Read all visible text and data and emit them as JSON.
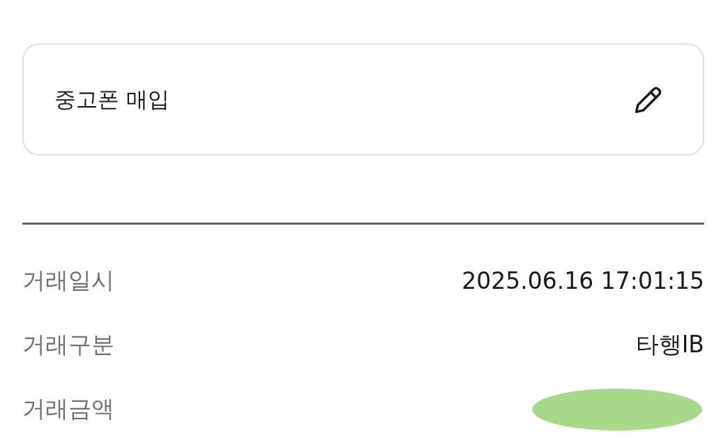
{
  "title_card": {
    "text": "중고폰 매입"
  },
  "details": [
    {
      "label": "거래일시",
      "value": "2025.06.16 17:01:15",
      "redacted": false
    },
    {
      "label": "거래구분",
      "value": "타행IB",
      "redacted": false
    },
    {
      "label": "거래금액",
      "redacted": true
    }
  ]
}
